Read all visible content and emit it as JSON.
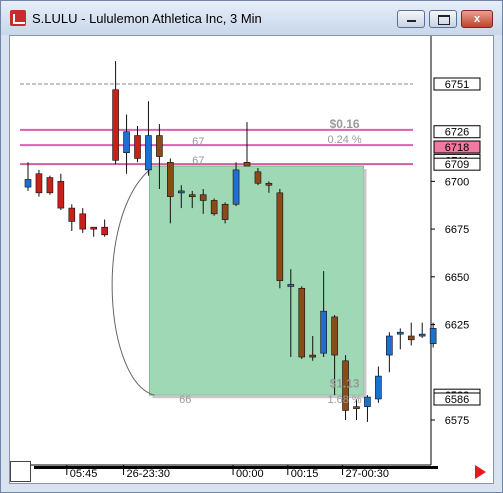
{
  "window": {
    "title": "S.LULU - Lululemon Athletica Inc, 3 Min",
    "minimize_icon": "minimize-icon",
    "maximize_icon": "maximize-icon",
    "close_icon": "close-icon",
    "close_glyph": "x"
  },
  "chart_data": {
    "type": "candlestick",
    "price_axis": {
      "ylim": [
        65.55,
        67.7
      ],
      "tick_labels": [
        {
          "value": 67.0,
          "label": "6700"
        },
        {
          "value": 66.75,
          "label": "6675"
        },
        {
          "value": 66.5,
          "label": "6650"
        },
        {
          "value": 66.25,
          "label": "6625"
        },
        {
          "value": 65.75,
          "label": "6575"
        }
      ],
      "price_markers": [
        {
          "value": 67.51,
          "label": "6751",
          "style": "boxed"
        },
        {
          "value": 67.26,
          "label": "6726",
          "style": "boxed"
        },
        {
          "value": 67.18,
          "label": "6718",
          "style": "highlight"
        },
        {
          "value": 67.11,
          "label": "6711",
          "style": "boxed"
        },
        {
          "value": 67.09,
          "label": "6709",
          "style": "boxed"
        },
        {
          "value": 65.88,
          "label": "6588",
          "style": "boxed"
        },
        {
          "value": 65.86,
          "label": "6586",
          "style": "boxed"
        }
      ]
    },
    "time_axis": {
      "labels": [
        "05:45",
        "26-23:30",
        "00:00",
        "00:15",
        "27-00:30"
      ]
    },
    "candles": [
      {
        "o": 67.01,
        "h": 67.1,
        "l": 66.95,
        "c": 66.97,
        "dir": "up"
      },
      {
        "o": 67.04,
        "h": 67.06,
        "l": 66.92,
        "c": 66.94,
        "dir": "down"
      },
      {
        "o": 66.94,
        "h": 67.03,
        "l": 66.93,
        "c": 67.02,
        "dir": "down"
      },
      {
        "o": 67.0,
        "h": 67.04,
        "l": 66.85,
        "c": 66.86,
        "dir": "down"
      },
      {
        "o": 66.86,
        "h": 66.88,
        "l": 66.74,
        "c": 66.79,
        "dir": "down"
      },
      {
        "o": 66.83,
        "h": 66.86,
        "l": 66.73,
        "c": 66.75,
        "dir": "down"
      },
      {
        "o": 66.76,
        "h": 66.76,
        "l": 66.71,
        "c": 66.75,
        "dir": "down"
      },
      {
        "o": 66.76,
        "h": 66.8,
        "l": 66.71,
        "c": 66.72,
        "dir": "down"
      },
      {
        "o": 67.48,
        "h": 67.63,
        "l": 67.09,
        "c": 67.11,
        "dir": "down"
      },
      {
        "o": 67.15,
        "h": 67.35,
        "l": 67.04,
        "c": 67.26,
        "dir": "up"
      },
      {
        "o": 67.24,
        "h": 67.29,
        "l": 67.1,
        "c": 67.12,
        "dir": "down"
      },
      {
        "o": 67.24,
        "h": 67.42,
        "l": 67.03,
        "c": 67.06,
        "dir": "up"
      },
      {
        "o": 67.24,
        "h": 67.3,
        "l": 66.96,
        "c": 67.13,
        "dir": "down"
      },
      {
        "o": 67.1,
        "h": 67.12,
        "l": 66.78,
        "c": 66.92,
        "dir": "down"
      },
      {
        "o": 66.94,
        "h": 66.98,
        "l": 66.86,
        "c": 66.95,
        "dir": "up"
      },
      {
        "o": 66.93,
        "h": 66.95,
        "l": 66.86,
        "c": 66.92,
        "dir": "down"
      },
      {
        "o": 66.93,
        "h": 66.96,
        "l": 66.83,
        "c": 66.9,
        "dir": "down"
      },
      {
        "o": 66.9,
        "h": 66.91,
        "l": 66.82,
        "c": 66.83,
        "dir": "down"
      },
      {
        "o": 66.88,
        "h": 66.89,
        "l": 66.78,
        "c": 66.8,
        "dir": "down"
      },
      {
        "o": 66.88,
        "h": 67.1,
        "l": 66.87,
        "c": 67.06,
        "dir": "up"
      },
      {
        "o": 67.1,
        "h": 67.31,
        "l": 67.08,
        "c": 67.08,
        "dir": "down"
      },
      {
        "o": 67.05,
        "h": 67.07,
        "l": 66.98,
        "c": 66.99,
        "dir": "down"
      },
      {
        "o": 66.99,
        "h": 67.0,
        "l": 66.94,
        "c": 66.99,
        "dir": "down"
      },
      {
        "o": 66.94,
        "h": 66.96,
        "l": 66.44,
        "c": 66.48,
        "dir": "down"
      },
      {
        "o": 66.46,
        "h": 66.54,
        "l": 66.08,
        "c": 66.46,
        "dir": "up"
      },
      {
        "o": 66.44,
        "h": 66.45,
        "l": 66.07,
        "c": 66.08,
        "dir": "down"
      },
      {
        "o": 66.08,
        "h": 66.19,
        "l": 66.06,
        "c": 66.09,
        "dir": "down"
      },
      {
        "o": 66.1,
        "h": 66.53,
        "l": 66.08,
        "c": 66.32,
        "dir": "up"
      },
      {
        "o": 66.29,
        "h": 66.3,
        "l": 65.88,
        "c": 66.09,
        "dir": "down"
      },
      {
        "o": 66.06,
        "h": 66.09,
        "l": 65.75,
        "c": 65.8,
        "dir": "down"
      },
      {
        "o": 65.81,
        "h": 65.86,
        "l": 65.75,
        "c": 65.82,
        "dir": "down"
      },
      {
        "o": 65.82,
        "h": 65.88,
        "l": 65.74,
        "c": 65.87,
        "dir": "up"
      },
      {
        "o": 65.86,
        "h": 66.03,
        "l": 65.84,
        "c": 65.98,
        "dir": "up"
      },
      {
        "o": 66.09,
        "h": 66.21,
        "l": 66.0,
        "c": 66.19,
        "dir": "up"
      },
      {
        "o": 66.2,
        "h": 66.23,
        "l": 66.12,
        "c": 66.21,
        "dir": "up"
      },
      {
        "o": 66.17,
        "h": 66.26,
        "l": 66.14,
        "c": 66.19,
        "dir": "down"
      },
      {
        "o": 66.2,
        "h": 66.26,
        "l": 66.18,
        "c": 66.2,
        "dir": "up"
      },
      {
        "o": 66.15,
        "h": 66.26,
        "l": 66.13,
        "c": 66.23,
        "dir": "up"
      }
    ],
    "horizontal_lines": [
      {
        "value": 67.51,
        "color": "#888888",
        "style": "dashed"
      },
      {
        "value": 67.27,
        "color": "#e060b0",
        "style": "solid"
      },
      {
        "value": 67.19,
        "color": "#e060b0",
        "style": "solid"
      },
      {
        "value": 67.09,
        "color": "#d060a0",
        "style": "solid"
      }
    ],
    "labels": [
      {
        "text": "$0.16",
        "value": 67.28,
        "bold": true
      },
      {
        "text": "0.24 %",
        "value": 67.2,
        "bold": false
      },
      {
        "text": "67",
        "value": 67.19,
        "bold": false
      },
      {
        "text": "67",
        "value": 67.09,
        "bold": false
      },
      {
        "text": "66",
        "value": 65.84,
        "bold": false
      },
      {
        "text": "$1.13",
        "value": 65.92,
        "bold": true
      },
      {
        "text": "1.68 %",
        "value": 65.84,
        "bold": false
      }
    ],
    "range_box": {
      "top": 67.08,
      "bottom": 65.88,
      "fill": "#9ed8b4",
      "edge": "#7fb994"
    },
    "colors": {
      "up": "#1e6fd0",
      "down": "#c8201a",
      "down_dark": "#8a4a1a",
      "highlight": "#f07aa0"
    }
  },
  "corner_icon": "grid-corner-icon",
  "nav_arrow_icon": "scroll-right-arrow-icon"
}
